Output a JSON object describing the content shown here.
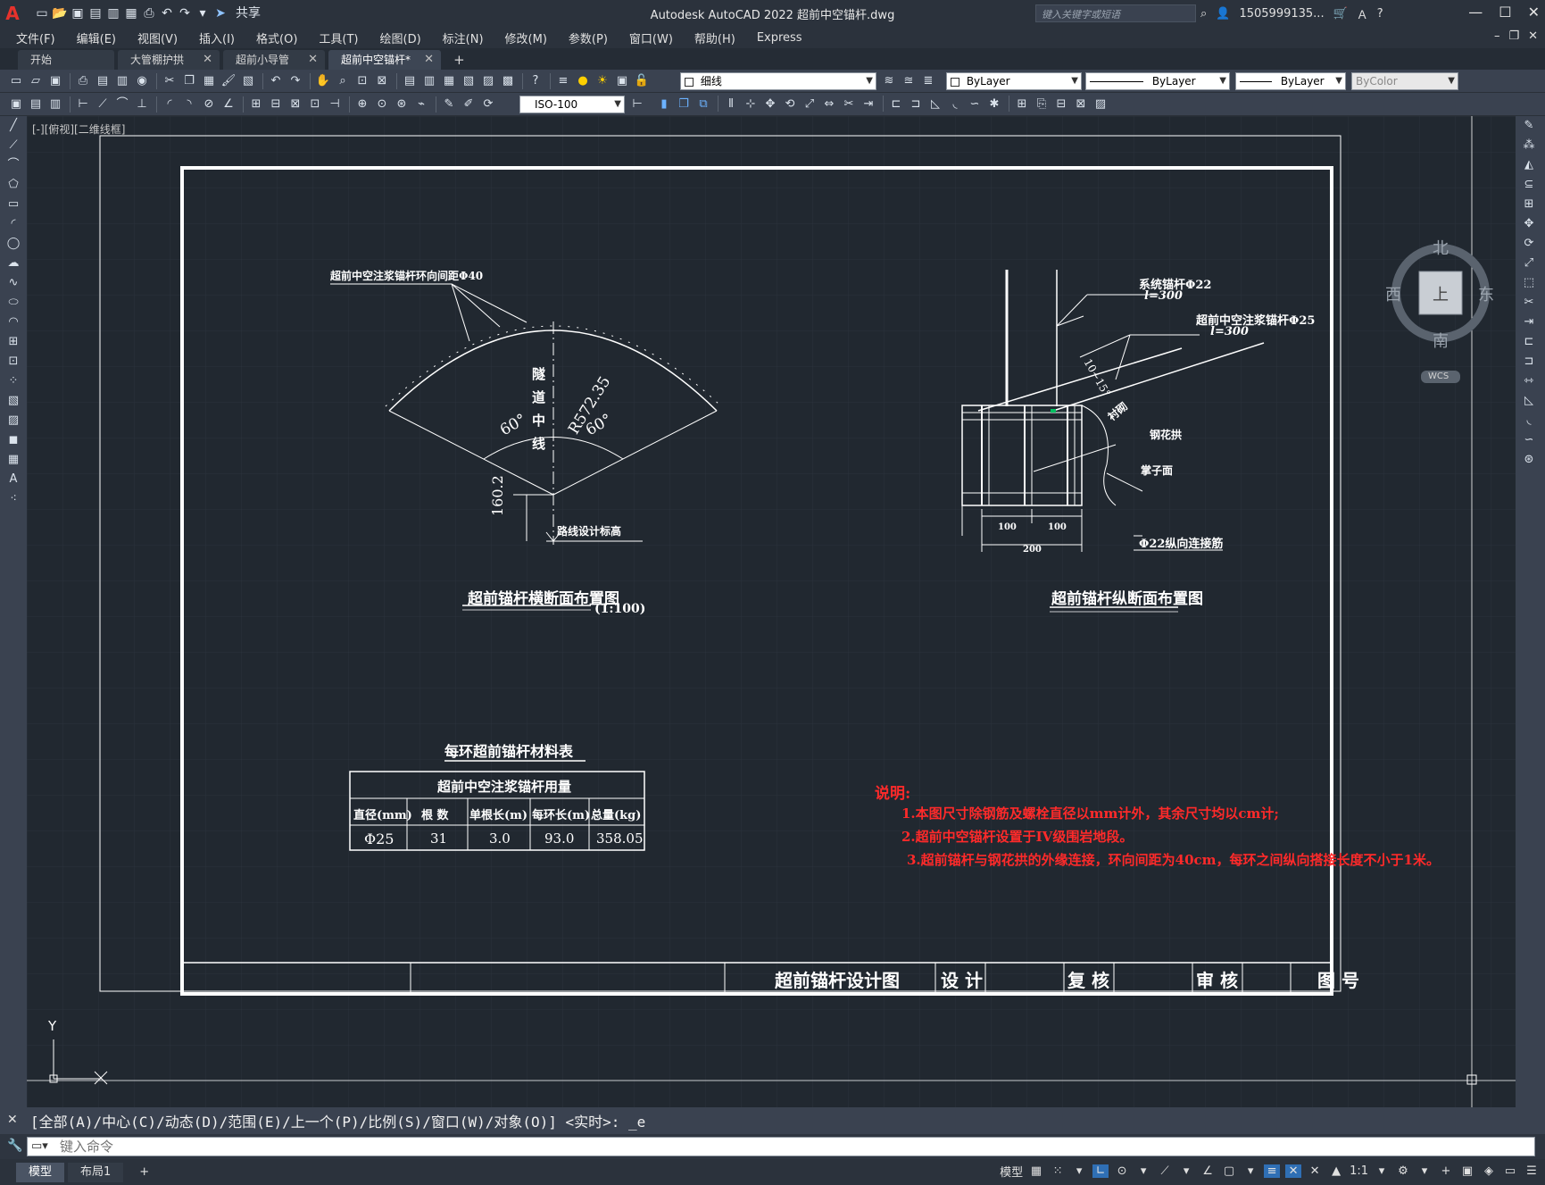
{
  "app": {
    "logo": "A",
    "share_label": "共享",
    "window_title": "Autodesk AutoCAD 2022    超前中空锚杆.dwg",
    "search_placeholder": "键入关键字或短语",
    "user": "1505999135...",
    "help_label": "?"
  },
  "menu": {
    "items": [
      "文件(F)",
      "编辑(E)",
      "视图(V)",
      "插入(I)",
      "格式(O)",
      "工具(T)",
      "绘图(D)",
      "标注(N)",
      "修改(M)",
      "参数(P)",
      "窗口(W)",
      "帮助(H)",
      "Express"
    ]
  },
  "file_tabs": [
    {
      "label": "开始",
      "closable": false
    },
    {
      "label": "大管棚护拱",
      "closable": true
    },
    {
      "label": "超前小导管",
      "closable": true
    },
    {
      "label": "超前中空锚杆*",
      "closable": true,
      "active": true
    }
  ],
  "properties": {
    "layer": "细线",
    "color": "ByLayer",
    "linetype": "ByLayer",
    "lineweight": "ByLayer",
    "plotstyle": "ByColor",
    "dimstyle": "ISO-100"
  },
  "viewport": {
    "label": "[-][俯视][二维线框]"
  },
  "viewcube": {
    "north": "北",
    "south": "南",
    "east": "东",
    "west": "西",
    "top": "上",
    "wcs": "WCS"
  },
  "drawing": {
    "left_figure": {
      "leader": "超前中空注浆锚杆环向间距Φ40",
      "centerline_chars": [
        "隧",
        "道",
        "中",
        "线"
      ],
      "angle_left": "60°",
      "angle_right": "60°",
      "radius": "R572.35",
      "height": "160.2",
      "grade_label": "路线设计标高",
      "title": "超前锚杆横断面布置图",
      "scale": "(1:100)"
    },
    "right_figure": {
      "label1_a": "系统锚杆Φ22",
      "label1_b": "l=300",
      "label2_a": "超前中空注浆锚杆Φ25",
      "label2_b": "l=300",
      "angle": "10~15°",
      "label3": "衬砌",
      "label4": "钢花拱",
      "label5": "掌子面",
      "label6": "Φ22纵向连接筋",
      "dim1": "100",
      "dim2": "100",
      "dim3": "200",
      "title": "超前锚杆纵断面布置图"
    },
    "table": {
      "title": "每环超前锚杆材料表",
      "header": "超前中空注浆锚杆用量",
      "columns": [
        "直径(mm)",
        "根 数",
        "单根长(m)",
        "每环长(m)",
        "总量(kg)"
      ],
      "rows": [
        [
          "Φ25",
          "31",
          "3.0",
          "93.0",
          "358.05"
        ]
      ]
    },
    "notes": {
      "title": "说明:",
      "items": [
        "1.本图尺寸除钢筋及螺栓直径以mm计外，其余尺寸均以cm计;",
        "2.超前中空锚杆设置于IV级围岩地段。",
        "3.超前锚杆与钢花拱的外缘连接，环向间距为40cm，每环之间纵向搭接长度不小于1米。"
      ]
    },
    "title_block": {
      "drawing_name": "超前锚杆设计图",
      "design": "设 计",
      "check": "复 核",
      "review": "审 核",
      "number": "图 号"
    },
    "ucs_y": "Y"
  },
  "command": {
    "history": "[全部(A)/中心(C)/动态(D)/范围(E)/上一个(P)/比例(S)/窗口(W)/对象(O)] <实时>: _e",
    "placeholder": "键入命令"
  },
  "layout_tabs": [
    {
      "label": "模型",
      "active": true
    },
    {
      "label": "布局1",
      "active": false
    }
  ],
  "status": {
    "model": "模型",
    "scale": "1:1"
  }
}
